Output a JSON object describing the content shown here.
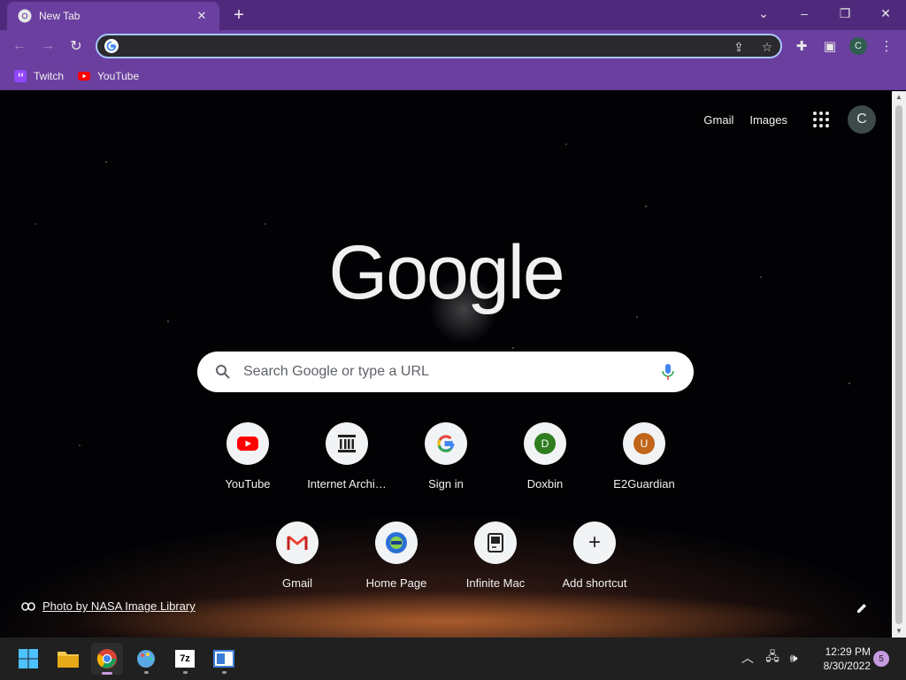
{
  "window": {
    "tab_title": "New Tab",
    "tab_favicon": "chrome-icon",
    "theme_color": "#6b3fa0",
    "controls": [
      "chevron-down-icon",
      "minimize-icon",
      "restore-icon",
      "close-icon"
    ]
  },
  "toolbar": {
    "omnibox_value": "",
    "omnibox_placeholder": "",
    "profile_initial": "C"
  },
  "bookmarks": [
    {
      "label": "Twitch",
      "icon": "twitch-icon"
    },
    {
      "label": "YouTube",
      "icon": "youtube-icon"
    }
  ],
  "ntp": {
    "links": {
      "gmail": "Gmail",
      "images": "Images"
    },
    "account_initial": "C",
    "logo_text": "Google",
    "search_placeholder": "Search Google or type a URL",
    "shortcuts": [
      {
        "label": "YouTube",
        "icon": "youtube-icon"
      },
      {
        "label": "Internet Archi…",
        "icon": "archive-icon"
      },
      {
        "label": "Sign in",
        "icon": "google-icon"
      },
      {
        "label": "Doxbin",
        "icon": "letter-d-icon",
        "letter": "D",
        "color": "#2e7d1f"
      },
      {
        "label": "E2Guardian",
        "icon": "letter-u-icon",
        "letter": "U",
        "color": "#c0651a"
      },
      {
        "label": "Gmail",
        "icon": "gmail-icon"
      },
      {
        "label": "Home Page",
        "icon": "pbs-kids-icon",
        "badge": "PBS KIDS"
      },
      {
        "label": "Infinite Mac",
        "icon": "mac-icon"
      },
      {
        "label": "Add shortcut",
        "icon": "plus-icon"
      }
    ],
    "credit": "Photo by NASA Image Library"
  },
  "taskbar": {
    "apps": [
      "windows-start-icon",
      "file-explorer-icon",
      "chrome-icon",
      "paint-icon",
      "7zip-icon",
      "app-window-icon"
    ],
    "time": "12:29 PM",
    "date": "8/30/2022",
    "notification_count": "5"
  }
}
